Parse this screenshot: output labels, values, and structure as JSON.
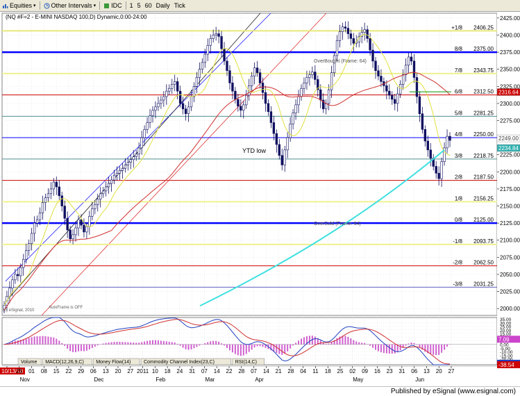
{
  "toolbar": {
    "items": [
      {
        "label": "Equities",
        "icon": "equities-icon"
      },
      {
        "label": "Other Intervals",
        "icon": "intervals-icon"
      },
      {
        "label": "IDC",
        "icon": "idc-icon"
      },
      {
        "label": "1"
      },
      {
        "label": "5"
      },
      {
        "label": "60"
      },
      {
        "label": "Daily"
      },
      {
        "label": "Tick"
      }
    ]
  },
  "chart": {
    "header": "(NQ #F=2 - E-MINI NASDAQ 100,D) Dynamic,0:00-24:00",
    "murrey_lines": [
      {
        "label": "+1/8",
        "value": 2406.25,
        "color": "#e8e87a",
        "width": 2
      },
      {
        "label": "8/8",
        "value": 2375,
        "color": "#0000ff",
        "width": 2.5
      },
      {
        "label": "7/8",
        "value": 2343.75,
        "color": "#f0f090",
        "width": 2
      },
      {
        "label": "6/8",
        "value": 2312.5,
        "color": "#cc0000",
        "width": 1
      },
      {
        "label": "5/8",
        "value": 2281.25,
        "color": "#4f8f8f",
        "width": 1
      },
      {
        "label": "4/8",
        "value": 2250,
        "color": "#0000ff",
        "width": 1
      },
      {
        "label": "3/8",
        "value": 2218.75,
        "color": "#4f8f8f",
        "width": 1
      },
      {
        "label": "2/8",
        "value": 2187.5,
        "color": "#cc0000",
        "width": 1
      },
      {
        "label": "1/8",
        "value": 2156.25,
        "color": "#f0f090",
        "width": 2
      },
      {
        "label": "0/8",
        "value": 2125,
        "color": "#0000ff",
        "width": 2.5
      },
      {
        "label": "-1/8",
        "value": 2093.75,
        "color": "#f0f090",
        "width": 2
      },
      {
        "label": "-2/8",
        "value": 2062.5,
        "color": "#cc0000",
        "width": 1
      },
      {
        "label": "-3/8",
        "value": 2031.25,
        "color": "#6060c0",
        "width": 1
      }
    ],
    "price_axis": [
      "2425.00",
      "2400.00",
      "2375.00",
      "2350.00",
      "2325.00",
      "2300.00",
      "2275.00",
      "2250.00",
      "2225.00",
      "2200.00",
      "2175.00",
      "2150.00",
      "2125.00",
      "2100.00",
      "2075.00",
      "2050.00",
      "2025.00",
      "2000.00"
    ],
    "price_range": [
      1990,
      2432
    ],
    "tags": [
      {
        "text": "2316.64",
        "value": 2316.64,
        "bg": "#cc0000",
        "fg": "#ffffff"
      },
      {
        "text": "2249.00",
        "value": 2249.0,
        "bg": "#ffffff",
        "fg": "#404040"
      },
      {
        "text": "2234.84",
        "value": 2234.84,
        "bg": "#30b0b0",
        "fg": "#ffffff"
      }
    ],
    "annotations": {
      "ytd_low": "YTD low",
      "overbought": "OverBought (Frame: 64)",
      "oversold": "OverSold (Frame: 64)",
      "autoframe": "AutoFrame is OFF",
      "copyright": "(c) eSignal, 2010"
    },
    "time_axis": {
      "labels": [
        "10/13/10",
        "25",
        "01",
        "08",
        "15",
        "22",
        "29",
        "06",
        "13",
        "20",
        "27",
        "2011",
        "10",
        "18",
        "24",
        "31",
        "07",
        "14",
        "22",
        "28",
        "07",
        "14",
        "21",
        "28",
        "04",
        "11",
        "18",
        "25",
        "02",
        "09",
        "16",
        "23",
        "31",
        "06",
        "13",
        "20",
        "27"
      ],
      "months": [
        "Nov",
        "Dec",
        "Feb",
        "Mar",
        "Apr",
        "May",
        "Jun"
      ]
    },
    "indicator_axis": [
      "35.00",
      "30.00",
      "25.00",
      "20.00",
      "15.00",
      "10.00",
      "5.00",
      "0.00",
      "-5.00",
      "-10.00",
      "-15.00",
      "-20.00",
      "-25.00"
    ],
    "indicator_range": [
      -28,
      37
    ],
    "indicator_tags": [
      {
        "text": "7.09",
        "value": 7.09,
        "bg": "#cc44cc",
        "fg": "#ffffff"
      },
      {
        "text": "-25.97",
        "value": -25.97,
        "bg": "#2040c0",
        "fg": "#ffffff"
      },
      {
        "text": "-38.54",
        "value": -28,
        "bg": "#cc0000",
        "fg": "#ffffff"
      }
    ],
    "pane_tabs": [
      "Volume",
      "MACD(12,26,9,C)",
      "Money Flow(14)",
      "Commodity Channel Index(23,C)",
      "RSI(14,C)"
    ]
  },
  "footer": {
    "text": "Published by eSignal (www.esignal.com)"
  },
  "chart_data": {
    "type": "candlestick",
    "title": "(NQ #F=2 - E-MINI NASDAQ 100,D) Dynamic,0:00-24:00",
    "ylim": [
      1990,
      2432
    ],
    "x_start": "10/13/10",
    "series": [
      {
        "name": "NQ #F=2",
        "closes": [
          2005,
          2018,
          2030,
          2042,
          2050,
          2048,
          2060,
          2072,
          2085,
          2095,
          2110,
          2125,
          2130,
          2140,
          2155,
          2162,
          2168,
          2175,
          2185,
          2178,
          2165,
          2150,
          2132,
          2115,
          2102,
          2108,
          2118,
          2130,
          2122,
          2112,
          2120,
          2135,
          2146,
          2152,
          2160,
          2168,
          2172,
          2178,
          2183,
          2188,
          2195,
          2198,
          2202,
          2205,
          2210,
          2214,
          2218,
          2222,
          2226,
          2235,
          2250,
          2262,
          2272,
          2282,
          2290,
          2295,
          2300,
          2305,
          2310,
          2318,
          2322,
          2328,
          2332,
          2318,
          2300,
          2292,
          2285,
          2295,
          2310,
          2325,
          2338,
          2350,
          2360,
          2372,
          2385,
          2395,
          2400,
          2402,
          2398,
          2380,
          2362,
          2348,
          2330,
          2318,
          2306,
          2296,
          2290,
          2298,
          2312,
          2326,
          2340,
          2352,
          2345,
          2330,
          2316,
          2300,
          2288,
          2272,
          2256,
          2240,
          2224,
          2210,
          2232,
          2250,
          2270,
          2286,
          2298,
          2310,
          2322,
          2330,
          2338,
          2342,
          2346,
          2335,
          2320,
          2305,
          2292,
          2300,
          2320,
          2345,
          2370,
          2392,
          2405,
          2412,
          2410,
          2402,
          2395,
          2388,
          2390,
          2398,
          2404,
          2408,
          2395,
          2378,
          2362,
          2348,
          2340,
          2332,
          2326,
          2318,
          2312,
          2306,
          2300,
          2314,
          2328,
          2342,
          2356,
          2368,
          2362,
          2338,
          2310,
          2285,
          2262,
          2245,
          2232,
          2220,
          2208,
          2198,
          2190,
          2215,
          2235,
          2252,
          2246
        ]
      }
    ]
  }
}
